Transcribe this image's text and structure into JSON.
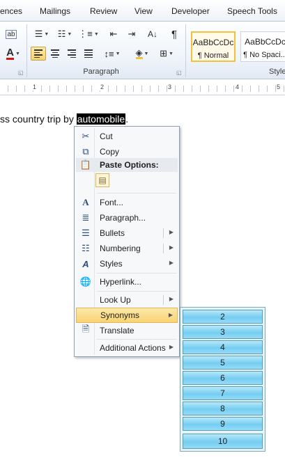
{
  "tabs": [
    "ences",
    "Mailings",
    "Review",
    "View",
    "Developer",
    "Speech Tools"
  ],
  "ribbon": {
    "paragraph_group_label": "Paragraph",
    "styles_group_label": "Style",
    "styles": [
      {
        "sample": "AaBbCcDc",
        "name": "¶ Normal",
        "selected": true
      },
      {
        "sample": "AaBbCcDc",
        "name": "¶ No Spaci...",
        "selected": false
      }
    ],
    "font_color_accent": "#e01010",
    "highlight_accent": "#f2c13b"
  },
  "ruler": {
    "numbers": [
      "1",
      "2",
      "3",
      "4",
      "5"
    ]
  },
  "document": {
    "text_before": "ss country trip by ",
    "selected_word": "automobile",
    "text_after": "."
  },
  "context_menu": {
    "cut": "Cut",
    "copy": "Copy",
    "paste_options": "Paste Options:",
    "font": "Font...",
    "paragraph": "Paragraph...",
    "bullets": "Bullets",
    "numbering": "Numbering",
    "styles": "Styles",
    "hyperlink": "Hyperlink...",
    "look_up": "Look Up",
    "synonyms": "Synonyms",
    "translate": "Translate",
    "additional_actions": "Additional Actions"
  },
  "synonyms": [
    "2",
    "3",
    "4",
    "5",
    "6",
    "7",
    "8",
    "9",
    "10"
  ]
}
